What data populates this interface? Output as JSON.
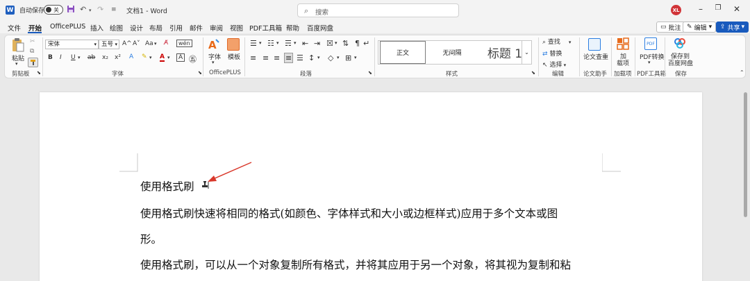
{
  "titlebar": {
    "app_icon": "W",
    "autosave_label": "自动保存",
    "autosave_state": "关",
    "doc_title": "文档1 - Word",
    "search_placeholder": "搜索",
    "avatar": "XL",
    "icons": [
      "word-icon",
      "save-icon",
      "undo-icon",
      "redo-icon",
      "customize-qat-icon",
      "search-icon",
      "minimize-icon",
      "restore-icon",
      "close-icon"
    ]
  },
  "menu": {
    "items": [
      "文件",
      "开始",
      "OfficePLUS",
      "插入",
      "绘图",
      "设计",
      "布局",
      "引用",
      "邮件",
      "审阅",
      "视图",
      "PDF工具箱",
      "帮助",
      "百度网盘"
    ],
    "active": "开始",
    "comment_label": "批注",
    "edit_label": "编辑",
    "share_label": "共享"
  },
  "ribbon": {
    "clipboard": {
      "paste": "粘贴",
      "group": "剪贴板"
    },
    "font": {
      "name": "宋体",
      "size": "五号",
      "group": "字体",
      "buttons": [
        "B",
        "I",
        "U",
        "ab",
        "x₂",
        "x²",
        "A",
        "A"
      ],
      "size_buttons": [
        "A^",
        "A˅",
        "Aa"
      ]
    },
    "officeplus": {
      "font_btn": "字体",
      "template_btn": "模板",
      "group": "OfficePLUS"
    },
    "paragraph": {
      "group": "段落"
    },
    "styles": {
      "items": [
        "正文",
        "无间隔",
        "标题 1"
      ],
      "group": "样式"
    },
    "editing": {
      "find": "查找",
      "replace": "替换",
      "select": "选择",
      "group": "编辑"
    },
    "essay": {
      "label": "论文查重",
      "group": "论文助手"
    },
    "addins": {
      "label1": "加",
      "label2": "载项",
      "group": "加载项"
    },
    "pdf": {
      "label": "PDF转换",
      "group": "PDF工具箱"
    },
    "save": {
      "label1": "保存到",
      "label2": "百度网盘",
      "group": "保存"
    }
  },
  "document": {
    "para1": "使用格式刷",
    "para2": "使用格式刷快速将相同的格式(如颜色、字体样式和大小或边框样式)应用于多个文本或图",
    "para3": "形。",
    "para4": "使用格式刷，可以从一个对象复制所有格式，并将其应用于另一个对象，将其视为复制和粘"
  },
  "colors": {
    "accent": "#185abd",
    "arrow": "#d9382b",
    "avatar": "#d13438"
  }
}
